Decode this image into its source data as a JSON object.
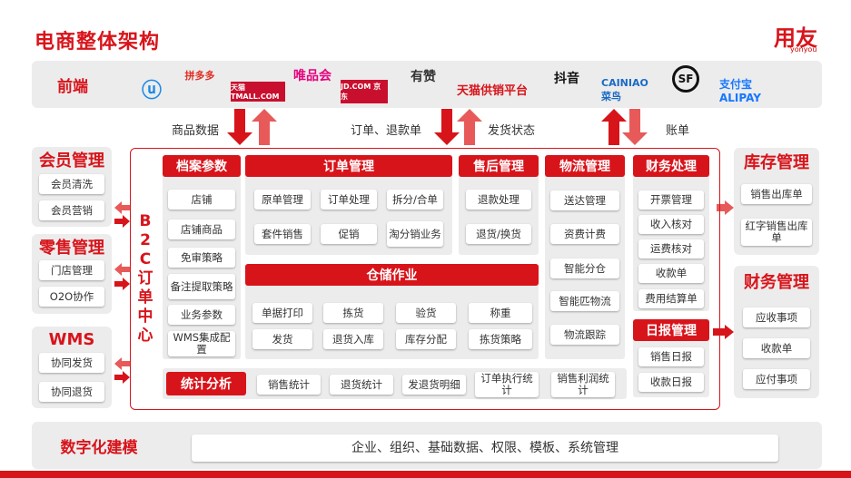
{
  "title": "电商整体架构",
  "brand": {
    "name": "用友",
    "sub": "yonyou"
  },
  "frontend": {
    "label": "前端",
    "logos": [
      "拼多多",
      "天猫TMALL.COM",
      "唯品会",
      "JD.COM 京东",
      "有赞",
      "天猫供销平台",
      "抖音",
      "CAINIAO 菜鸟",
      "SF",
      "支付宝 ALIPAY"
    ]
  },
  "flows": {
    "product_data": "商品数据",
    "order_refund": "订单、退款单",
    "ship_status": "发货状态",
    "bill": "账单"
  },
  "member": {
    "title": "会员管理",
    "items": [
      "会员清洗",
      "会员营销"
    ]
  },
  "retail": {
    "title": "零售管理",
    "items": [
      "门店管理",
      "O2O协作"
    ]
  },
  "wms": {
    "title": "WMS",
    "items": [
      "协同发货",
      "协同退货"
    ]
  },
  "b2c": {
    "label": "B2C订单中心"
  },
  "archive": {
    "title": "档案参数",
    "items": [
      "店铺",
      "店铺商品",
      "免审策略",
      "备注提取策略",
      "业务参数",
      "WMS集成配置"
    ]
  },
  "order": {
    "title": "订单管理",
    "items": [
      "原单管理",
      "订单处理",
      "拆分/合单",
      "套件销售",
      "促销",
      "淘分销业务"
    ]
  },
  "aftersale": {
    "title": "售后管理",
    "items": [
      "退款处理",
      "退货/换货"
    ]
  },
  "logistics": {
    "title": "物流管理",
    "items": [
      "送达管理",
      "资费计费",
      "智能分仓",
      "智能匹物流",
      "物流跟踪"
    ]
  },
  "finproc": {
    "title": "财务处理",
    "items": [
      "开票管理",
      "收入核对",
      "运费核对",
      "收款单",
      "费用结算单"
    ]
  },
  "warehouse": {
    "title": "仓储作业",
    "items": [
      "单据打印",
      "拣货",
      "验货",
      "称重",
      "发货",
      "退货入库",
      "库存分配",
      "拣货策略"
    ]
  },
  "daily": {
    "title": "日报管理",
    "items": [
      "销售日报",
      "收款日报"
    ]
  },
  "stats": {
    "title": "统计分析",
    "items": [
      "销售统计",
      "退货统计",
      "发退货明细",
      "订单执行统计",
      "销售利润统计"
    ]
  },
  "inventory": {
    "title": "库存管理",
    "items": [
      "销售出库单",
      "红字销售出库单"
    ]
  },
  "finance": {
    "title": "财务管理",
    "items": [
      "应收事项",
      "收款单",
      "应付事项"
    ]
  },
  "digital": {
    "label": "数字化建模",
    "content": "企业、组织、基础数据、权限、模板、系统管理"
  },
  "colors": {
    "accent": "#d8141b",
    "panel": "#ececec"
  }
}
